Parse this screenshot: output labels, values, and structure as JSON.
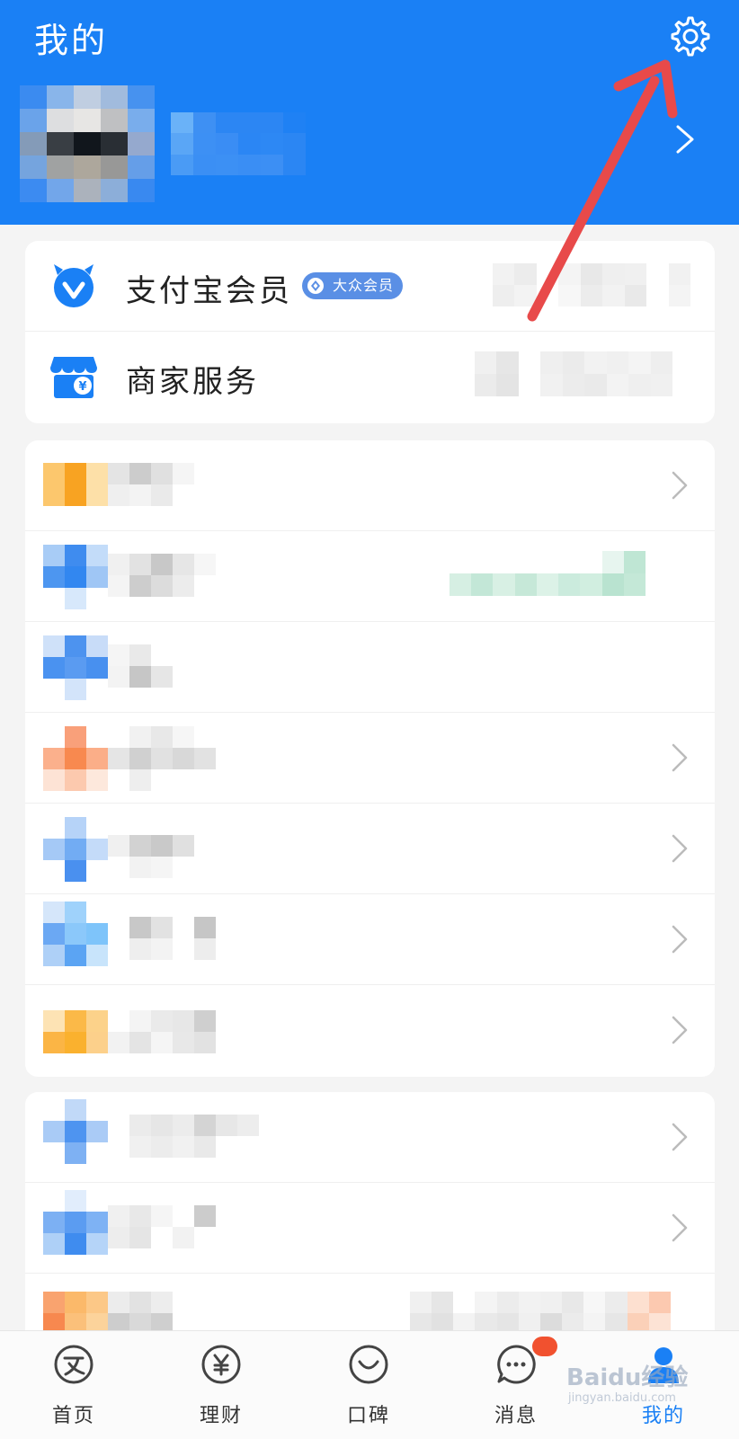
{
  "header": {
    "title": "我的",
    "settings_icon": "gear-icon",
    "background": "#1a80f5"
  },
  "profile": {
    "avatar": "blurred-avatar",
    "name": "",
    "chevron_icon": "chevron-right-icon"
  },
  "services": [
    {
      "label": "支付宝会员",
      "icon": "alipay-member-icon",
      "badge": "大众会员"
    },
    {
      "label": "商家服务",
      "icon": "merchant-store-icon"
    }
  ],
  "menu_rows_count_group1": 7,
  "menu_rows_count_group2": 3,
  "tabbar": {
    "items": [
      {
        "label": "首页",
        "icon": "home-icon"
      },
      {
        "label": "理财",
        "icon": "wealth-icon"
      },
      {
        "label": "口碑",
        "icon": "koubei-icon"
      },
      {
        "label": "消息",
        "icon": "message-icon"
      },
      {
        "label": "我的",
        "icon": "profile-icon",
        "active": true
      }
    ]
  },
  "watermark": {
    "text": "Baidu经验",
    "sub": "jingyan.baidu.com"
  },
  "colors": {
    "accent": "#1a80f5",
    "annotation_arrow": "#e84a4a",
    "badge": "#5a8fe5"
  }
}
